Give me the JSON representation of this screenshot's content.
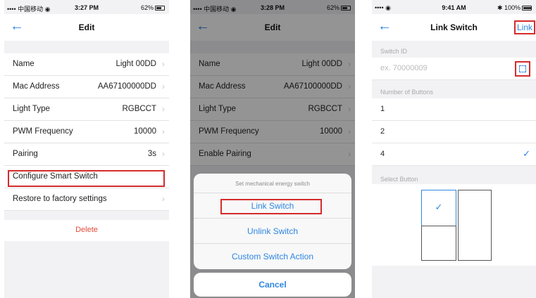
{
  "phone1": {
    "status": {
      "signal": "•••• 中国移动 ◉",
      "time": "3:27 PM",
      "battery": "62%"
    },
    "nav": {
      "back": "←",
      "title": "Edit"
    },
    "rows": [
      {
        "label": "Name",
        "value": "Light 00DD"
      },
      {
        "label": "Mac Address",
        "value": "AA67100000DD"
      },
      {
        "label": "Light Type",
        "value": "RGBCCT"
      },
      {
        "label": "PWM Frequency",
        "value": "10000"
      },
      {
        "label": "Pairing",
        "value": "3s"
      },
      {
        "label": "Configure Smart Switch",
        "value": ""
      },
      {
        "label": "Restore to factory settings",
        "value": ""
      }
    ],
    "delete_label": "Delete"
  },
  "phone2": {
    "status": {
      "signal": "•••• 中国移动 ◉",
      "time": "3:28 PM",
      "battery": "62%"
    },
    "nav": {
      "back": "←",
      "title": "Edit"
    },
    "rows": [
      {
        "label": "Name",
        "value": "Light 00DD"
      },
      {
        "label": "Mac Address",
        "value": "AA67100000DD"
      },
      {
        "label": "Light Type",
        "value": "RGBCCT"
      },
      {
        "label": "PWM Frequency",
        "value": "10000"
      },
      {
        "label": "Enable Pairing",
        "value": ""
      }
    ],
    "sheet": {
      "title": "Set mechanical energy switch",
      "actions": [
        "Link Switch",
        "Unlink Switch",
        "Custom Switch Action"
      ],
      "cancel": "Cancel"
    }
  },
  "phone3": {
    "status": {
      "signal": "•••• ◉",
      "time": "9:41 AM",
      "battery": "✱ 100%"
    },
    "nav": {
      "back": "←",
      "title": "Link Switch",
      "right": "Link"
    },
    "switch_id_header": "Switch ID",
    "switch_id_placeholder": "ex. 70000009",
    "buttons_header": "Number of Buttons",
    "button_options": [
      "1",
      "2",
      "4"
    ],
    "selected_option": "4",
    "select_button_header": "Select Button"
  },
  "colors": {
    "accent": "#2f86e0",
    "highlight": "#d52b2b",
    "danger": "#e24b3b"
  }
}
